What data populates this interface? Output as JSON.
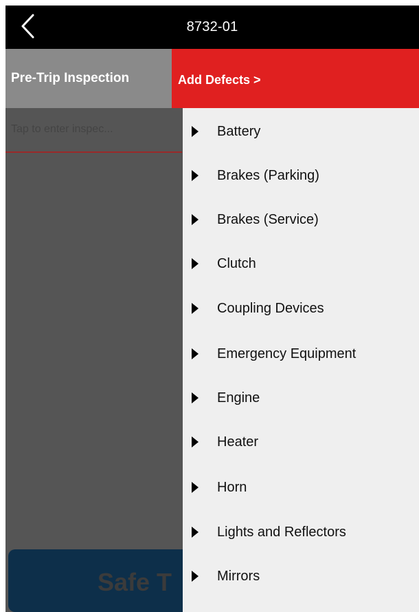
{
  "topbar": {
    "title": "8732-01"
  },
  "header": {
    "title": "Pre-Trip Inspection"
  },
  "notes": {
    "placeholder": "Tap to enter inspec..."
  },
  "safe_button": {
    "label": "Safe T"
  },
  "add_defects": {
    "label": "Add Defects >"
  },
  "defects": [
    {
      "label": "Battery"
    },
    {
      "label": "Brakes (Parking)"
    },
    {
      "label": "Brakes (Service)"
    },
    {
      "label": "Clutch"
    },
    {
      "label": "Coupling Devices"
    },
    {
      "label": "Emergency Equipment"
    },
    {
      "label": "Engine"
    },
    {
      "label": "Heater"
    },
    {
      "label": "Horn"
    },
    {
      "label": "Lights and Reflectors"
    },
    {
      "label": "Mirrors"
    }
  ],
  "colors": {
    "topbar": "#000000",
    "header": "#8a8a8a",
    "accent_red": "#e02020",
    "panel": "#efefef",
    "content_bg": "#555555"
  }
}
